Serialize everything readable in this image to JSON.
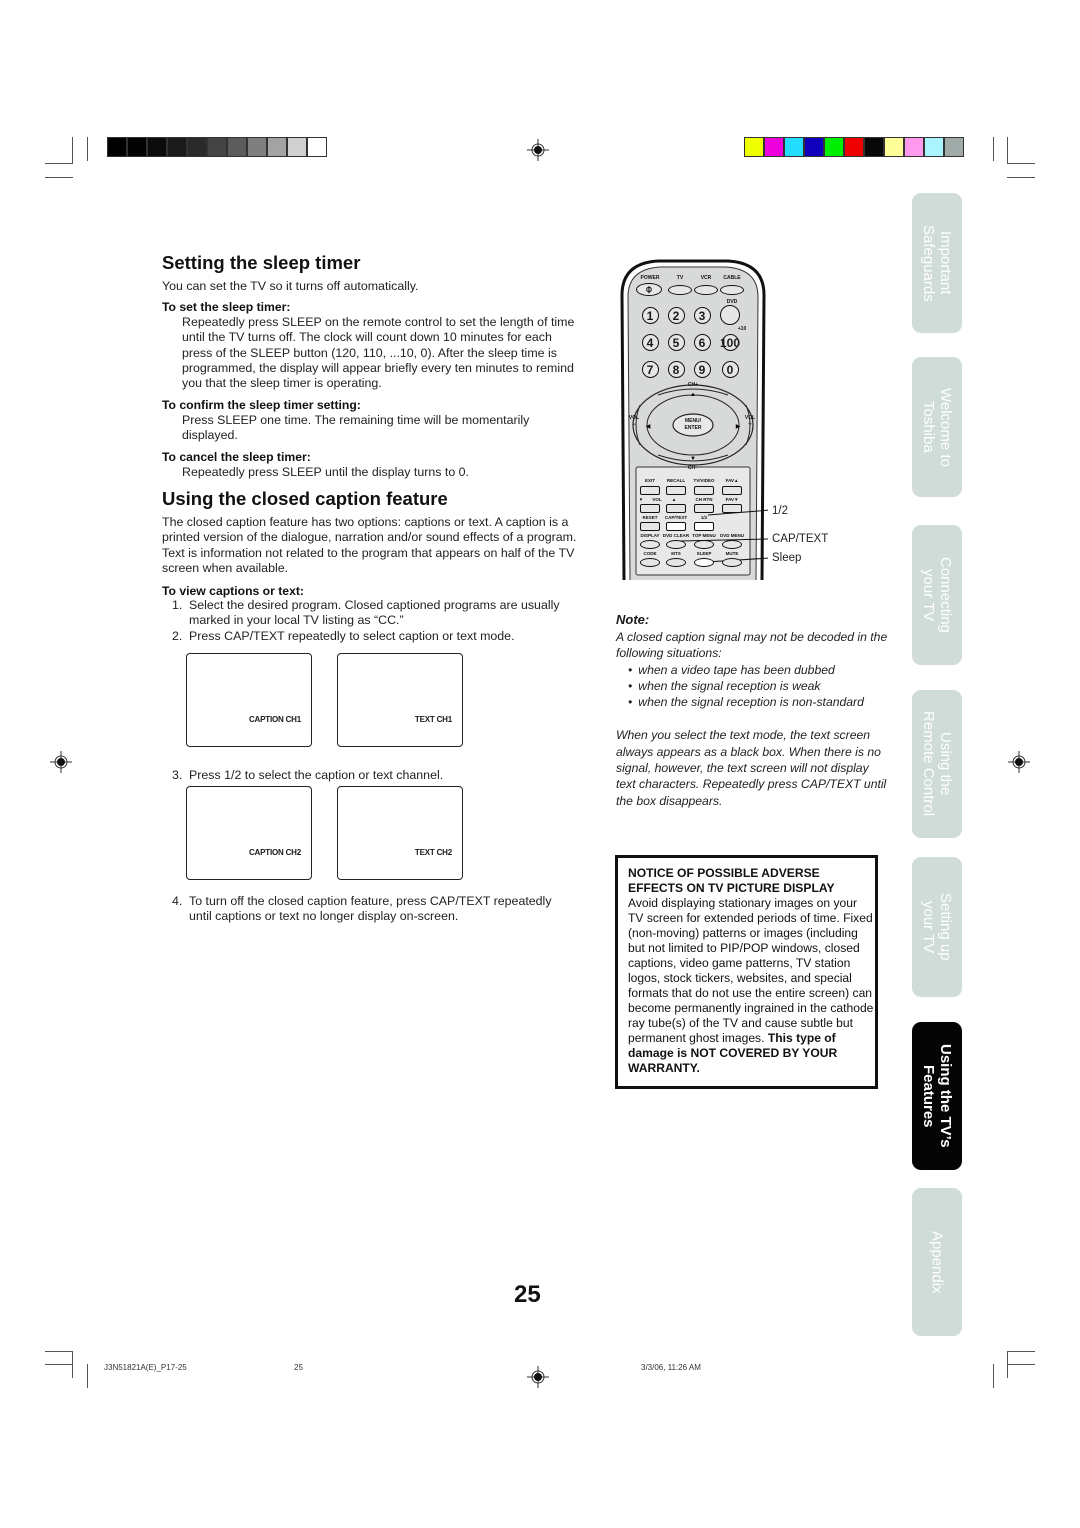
{
  "grayscale_bar": [
    "#000000",
    "#030303",
    "#0c0c0c",
    "#1a1a1a",
    "#2a2a2a",
    "#444444",
    "#5c5c5c",
    "#7e7e7e",
    "#a3a3a3",
    "#d0d0d0",
    "#ffffff"
  ],
  "color_bar": [
    "#eeff00",
    "#ee00dd",
    "#22ddff",
    "#1100bb",
    "#00ee00",
    "#ee0000",
    "#080808",
    "#ffff99",
    "#ff99ee",
    "#aaf4ff",
    "#a0aaa8"
  ],
  "sleep_timer": {
    "title": "Setting the sleep timer",
    "intro": "You can set the TV so it turns off automatically.",
    "set_heading": "To set the sleep timer:",
    "set_body": "Repeatedly press SLEEP on the remote control to set the length of time until the TV turns off. The clock will count down 10 minutes for each press of the SLEEP button (120, 110, ...10, 0). After the sleep time is programmed, the display will appear briefly every ten minutes to remind you that the sleep timer is operating.",
    "confirm_heading": "To confirm the sleep timer setting:",
    "confirm_body": "Press SLEEP one time. The remaining time will be momentarily displayed.",
    "cancel_heading": "To cancel the sleep timer:",
    "cancel_body": "Repeatedly press SLEEP until the display turns to 0."
  },
  "closed_caption": {
    "title": "Using the closed caption feature",
    "intro": "The closed caption feature has two options: captions or text. A caption is a printed version of the dialogue, narration and/or sound effects of a program. Text is information not related to the program that appears on half of the TV screen when available.",
    "view_heading": "To view captions or text:",
    "steps": [
      {
        "num": "1.",
        "text": "Select the desired program. Closed captioned programs are usually marked in your local TV listing as “CC.”"
      },
      {
        "num": "2.",
        "text": "Press CAP/TEXT repeatedly to select caption or text mode."
      },
      {
        "num": "3.",
        "text": "Press 1/2 to select the caption or text channel."
      },
      {
        "num": "4.",
        "text": "To turn off the closed caption feature, press CAP/TEXT repeatedly until captions or text no longer display on-screen."
      }
    ],
    "screens_row1": [
      "CAPTION CH1",
      "TEXT CH1"
    ],
    "screens_row2": [
      "CAPTION CH2",
      "TEXT CH2"
    ]
  },
  "remote": {
    "top_labels": [
      "POWER",
      "TV",
      "VCR",
      "CABLE"
    ],
    "dvd_label": "DVD",
    "plus10_label": "+10",
    "digits": [
      "1",
      "2",
      "3",
      "",
      "4",
      "5",
      "6",
      "100",
      "7",
      "8",
      "9",
      "0"
    ],
    "ch_plus": "CH+",
    "ch_minus": "CH−",
    "vol_left": "VOL",
    "vol_right": "VOL",
    "minus": "−",
    "plus": "+",
    "menu": "MENU/",
    "enter": "ENTER",
    "row_a": [
      "EXIT",
      "RECALL",
      "TV/VIDEO",
      "FAV▲"
    ],
    "row_b": [
      "▼",
      "VOL",
      "▲",
      "CH RTN",
      "FAV▼"
    ],
    "row_c": [
      "RESET",
      "CAP/TEXT",
      "1/2"
    ],
    "row_d": [
      "DISPLAY",
      "DVD CLEAR",
      "TOP MENU",
      "DVD MENU"
    ],
    "row_e": [
      "CODE",
      "MTS",
      "SLEEP",
      "MUTE"
    ],
    "callouts": [
      "1/2",
      "CAP/TEXT",
      "Sleep"
    ]
  },
  "note": {
    "title": "Note:",
    "intro": "A closed caption signal may not be decoded in the following situations:",
    "bullets": [
      "when a video tape has been dubbed",
      "when the signal reception is weak",
      "when the signal reception is non-standard"
    ],
    "text_mode": "When you select the text mode, the text screen always appears as a black box. When there is no signal, however, the text screen will not display text characters. Repeatedly press CAP/TEXT until the box disappears."
  },
  "notice": {
    "heading1": "NOTICE OF POSSIBLE ADVERSE",
    "heading2": "EFFECTS ON TV PICTURE DISPLAY",
    "body": "Avoid displaying stationary images on your TV screen for extended periods of time. Fixed (non-moving) patterns or images (including but not limited to PIP/POP windows, closed captions, video game patterns, TV station logos, stock tickers, websites, and special formats that do not use the entire screen) can become permanently ingrained in the cathode ray tube(s) of the TV and cause subtle but permanent ghost images.",
    "bold_tail": "This type of damage is NOT COVERED BY YOUR WARRANTY."
  },
  "side_tabs": [
    {
      "label": "Important\nSafeguards",
      "active": false
    },
    {
      "label": "Welcome to\nToshiba",
      "active": false
    },
    {
      "label": "Connecting\nyour TV",
      "active": false
    },
    {
      "label": "Using the\nRemote Control",
      "active": false
    },
    {
      "label": "Setting up\nyour TV",
      "active": false
    },
    {
      "label": "Using the TV’s\nFeatures",
      "active": true
    },
    {
      "label": "Appendix",
      "active": false
    }
  ],
  "page_number": "25",
  "footer": {
    "file": "J3N51821A(E)_P17-25",
    "page": "25",
    "timestamp": "3/3/06, 11:26 AM"
  }
}
